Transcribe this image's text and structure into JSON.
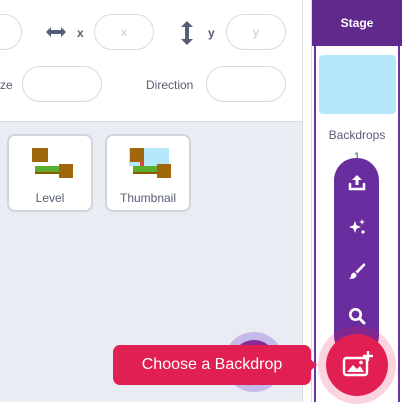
{
  "info": {
    "x_label": "x",
    "x_placeholder": "x",
    "y_label": "y",
    "y_placeholder": "y",
    "size_label_partial": "ze",
    "direction_label": "Direction"
  },
  "sprites": [
    {
      "name": "Level"
    },
    {
      "name": "Thumbnail"
    }
  ],
  "stage": {
    "header": "Stage",
    "backdrops_label": "Backdrops",
    "backdrops_count": "1"
  },
  "backdrop_menu": {
    "items": [
      {
        "icon": "upload-icon"
      },
      {
        "icon": "surprise-icon"
      },
      {
        "icon": "paint-icon"
      },
      {
        "icon": "search-icon"
      }
    ],
    "main_icon": "backdrop-add-icon",
    "tooltip": "Choose a Backdrop"
  },
  "colors": {
    "purple": "#5f2a8c",
    "accent_red": "#e21f52",
    "stage_sky": "#b6e8fb",
    "pane_bg": "#e9edf3"
  }
}
